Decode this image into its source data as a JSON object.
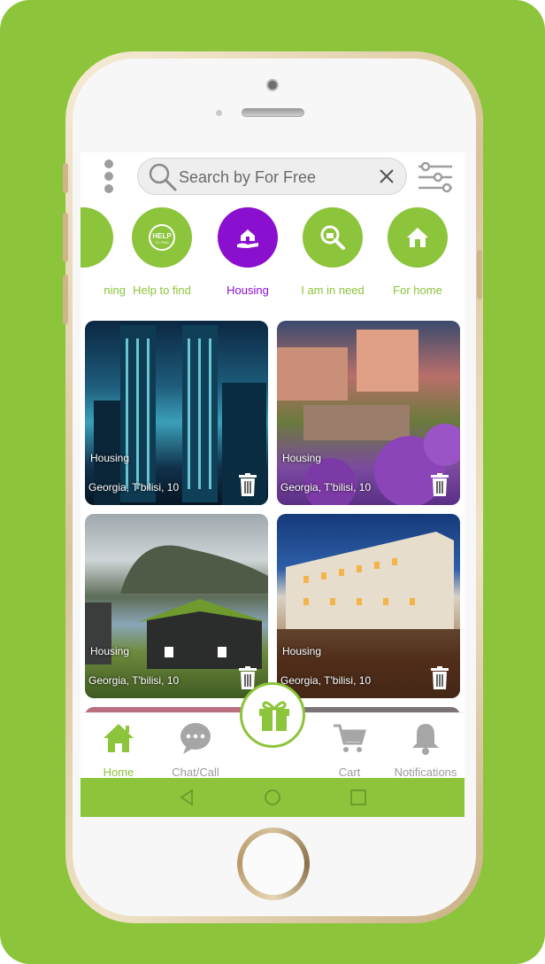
{
  "search": {
    "placeholder": "Search by For Free"
  },
  "categories": [
    {
      "label": "ning",
      "icon": "partial-icon"
    },
    {
      "label": "Help to find",
      "icon": "help-badge-icon"
    },
    {
      "label": "Housing",
      "icon": "house-hand-icon",
      "active": true
    },
    {
      "label": "I am in need",
      "icon": "magnifier-bag-icon"
    },
    {
      "label": "For home",
      "icon": "home-icon"
    }
  ],
  "listings": [
    {
      "type": "Housing",
      "location": "Georgia, T'bilisi, 10"
    },
    {
      "type": "Housing",
      "location": "Georgia, T'bilisi, 10"
    },
    {
      "type": "Housing",
      "location": "Georgia, T'bilisi, 10"
    },
    {
      "type": "Housing",
      "location": "Georgia, T'bilisi, 10"
    }
  ],
  "nav": {
    "home": "Home",
    "chat": "Chat/Call",
    "cart": "Cart",
    "notifications": "Notifications"
  },
  "colors": {
    "accent": "#8cc43b",
    "active": "#8a0fcf",
    "inactive": "#9c9c9c"
  }
}
